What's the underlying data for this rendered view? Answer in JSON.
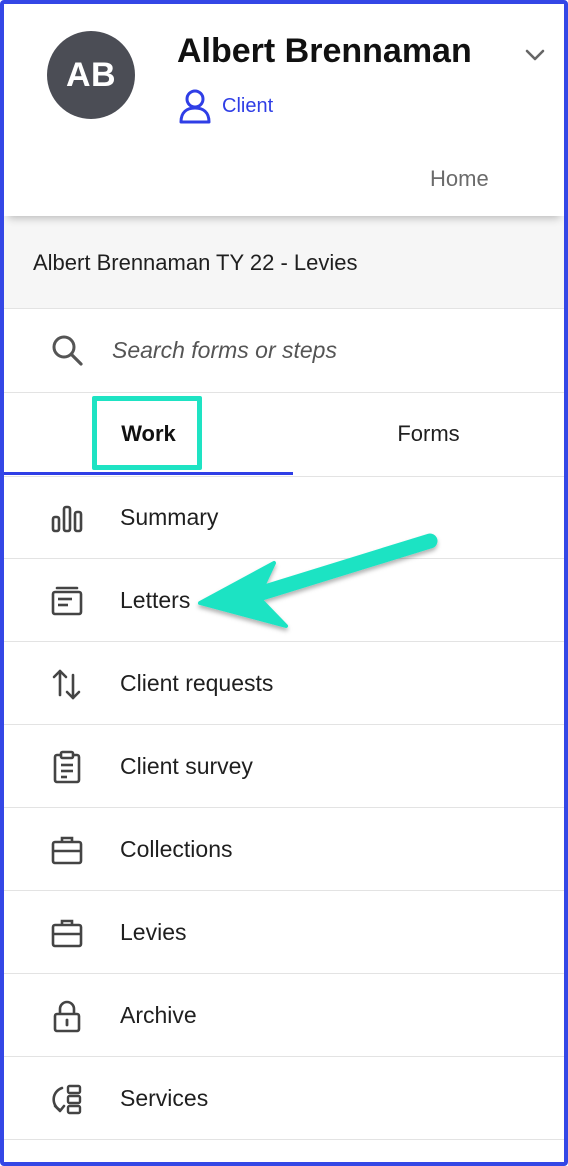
{
  "header": {
    "avatar_initials": "AB",
    "client_name": "Albert Brennaman",
    "client_type": "Client",
    "home_link": "Home"
  },
  "project": {
    "title": "Albert Brennaman TY 22 - Levies"
  },
  "search": {
    "placeholder": "Search forms or steps"
  },
  "tabs": [
    {
      "label": "Work",
      "active": true
    },
    {
      "label": "Forms",
      "active": false
    }
  ],
  "nav": {
    "items": [
      {
        "label": "Summary",
        "icon": "bar-chart-icon"
      },
      {
        "label": "Letters",
        "icon": "letter-tray-icon"
      },
      {
        "label": "Client requests",
        "icon": "transfer-arrows-icon"
      },
      {
        "label": "Client survey",
        "icon": "clipboard-icon"
      },
      {
        "label": "Collections",
        "icon": "briefcase-icon"
      },
      {
        "label": "Levies",
        "icon": "briefcase-icon"
      },
      {
        "label": "Archive",
        "icon": "lock-icon"
      },
      {
        "label": "Services",
        "icon": "services-list-icon"
      }
    ]
  },
  "colors": {
    "accent": "#2f3ee6",
    "frame": "#3447e6",
    "annotation": "#1ee3c3",
    "avatar_bg": "#4b4d55"
  }
}
